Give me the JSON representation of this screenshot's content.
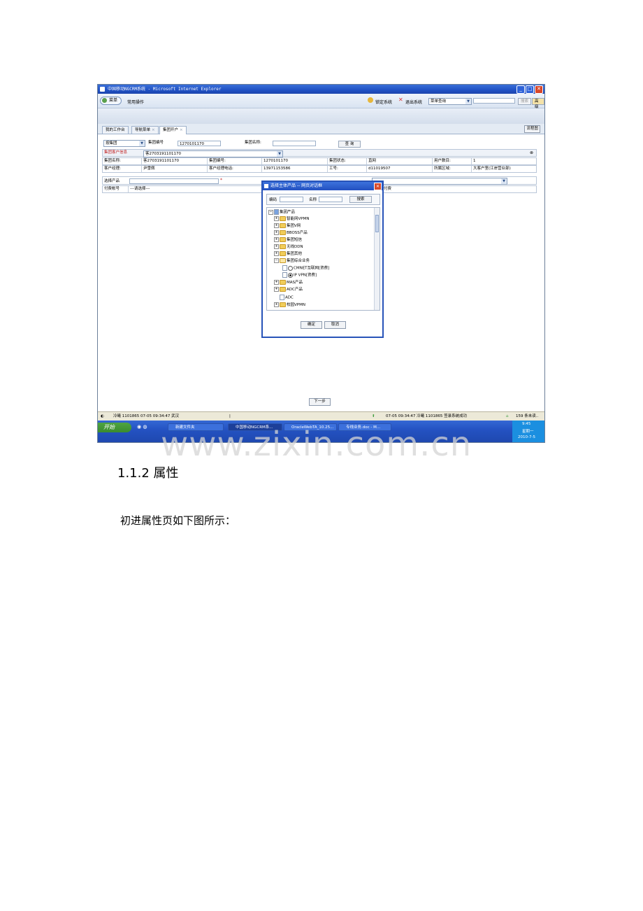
{
  "window": {
    "title": "中国移动NGCRM系统 - Microsoft Internet Explorer",
    "min": "_",
    "max": "□",
    "close": "✕"
  },
  "toolbar": {
    "menu": "菜单",
    "common_ops": "常用操作",
    "lock": "锁定系统",
    "logout": "退出系统",
    "menu_query_value": "菜单查询",
    "search_btn": "搜索",
    "advanced_btn": "高级"
  },
  "tabs": [
    {
      "label": "我的工作台"
    },
    {
      "label": "导航菜单"
    },
    {
      "label": "集团开户"
    }
  ],
  "flow_chart_btn": "流程图",
  "search_row": {
    "type_value": "按集团",
    "group_no_label": "集团编号",
    "group_no_value": "1270101170",
    "group_name_label": "集团名称:",
    "query_btn": "查 询"
  },
  "customer_info": {
    "header_label": "集团客户信息",
    "selected_customer": "客2703191101170",
    "collapse": "⊗",
    "row1": {
      "name_label": "集团名称:",
      "name_value": "客2703191101170",
      "no_label": "集团编号:",
      "no_value": "1270101170",
      "status_label": "集团状态:",
      "status_value": "直网",
      "users_label": "用户数目:",
      "users_value": "1"
    },
    "row2": {
      "manager_label": "客户经理:",
      "manager_value": "尹雪佩",
      "phone_label": "客户经理电话:",
      "phone_value": "13971153586",
      "job_label": "工号:",
      "job_value": "d11019507",
      "area_label": "所属区域:",
      "area_value": "大客户室(江岸营业部)"
    }
  },
  "product_row": {
    "label": "选择产品",
    "required": "*"
  },
  "account_row": {
    "label": "付费帐号",
    "value": "---请选择---",
    "pay_label": "付费"
  },
  "next_btn": "下一步",
  "dialog": {
    "title": "选择主体产品 -- 网页对话框",
    "close": "✕",
    "code_label": "编码",
    "name_label": "名称",
    "search_btn": "搜索",
    "ok_btn": "确定",
    "cancel_btn": "取消",
    "tree": {
      "root": "集团产品",
      "items": [
        "智能网VPMN",
        "集团V网",
        "BBOSS产品",
        "集团短信",
        "无线DDN",
        "集团其他",
        "集团综合业务"
      ],
      "sub_items": [
        "CMNET互联网[资费]",
        "IP VPN[资费]"
      ],
      "after": [
        "MAS产品",
        "ADC产品",
        "ADC",
        "校园VPMN"
      ]
    }
  },
  "statusbar": {
    "left": "冷曦 1101865  07-05 09:34:47 武汉",
    "sep": "|",
    "middle": "07-05 09:34:47 冷曦 1101865 签录系统成功",
    "right": "159 条未读.."
  },
  "taskbar": {
    "start": "开始",
    "tasks": [
      "新建文件夹",
      "中国移动NGCRM系...",
      "OracleWebTA_10.25...",
      "专线业务.doc - M..."
    ],
    "clock": "9:45",
    "weekday": "星期一",
    "date": "2010-7-5"
  },
  "watermark": "www.zixin.com.cn",
  "heading": "1.1.2  属性",
  "paragraph": "初进属性页如下图所示："
}
